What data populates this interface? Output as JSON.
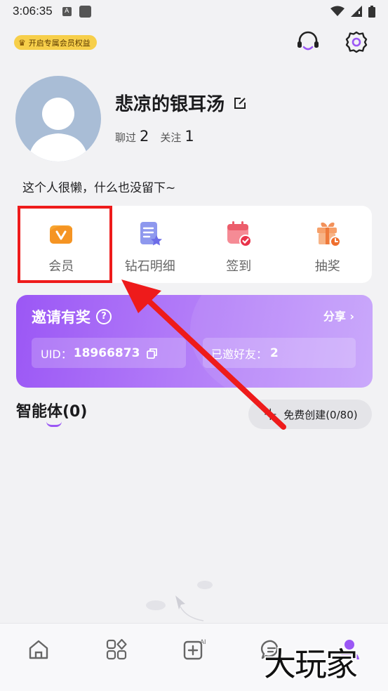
{
  "status_bar": {
    "time": "3:06:35",
    "a_icon": "A"
  },
  "vip_chip": {
    "label": "开启专属会员权益",
    "icon": "crown-icon"
  },
  "profile": {
    "nickname": "悲凉的银耳汤",
    "chatted_label": "聊过",
    "chatted_count": "2",
    "following_label": "关注",
    "following_count": "1",
    "bio": "这个人很懒，什么也没留下~"
  },
  "quick_actions": [
    {
      "label": "会员",
      "icon": "vip-icon"
    },
    {
      "label": "钻石明细",
      "icon": "diamond-detail-icon"
    },
    {
      "label": "签到",
      "icon": "checkin-icon"
    },
    {
      "label": "抽奖",
      "icon": "lottery-gift-icon"
    }
  ],
  "invite": {
    "title": "邀请有奖",
    "help": "?",
    "share_label": "分享 ›",
    "uid_label": "UID：",
    "uid_value": "18966873",
    "invited_label": "已邀好友：",
    "invited_value": "2"
  },
  "agents": {
    "title": "智能体(0)",
    "create_label": "免费创建(0/80)",
    "create_plus": "+"
  },
  "tabs": [
    {
      "icon": "home-icon"
    },
    {
      "icon": "apps-grid-icon"
    },
    {
      "icon": "ai-create-icon"
    },
    {
      "icon": "chat-icon"
    },
    {
      "icon": "profile-icon"
    }
  ],
  "watermark": "大玩家",
  "colors": {
    "accent_purple": "#9b57f5",
    "vip_gold": "#f7cf4a",
    "annotation_red": "#ee1b1b"
  }
}
